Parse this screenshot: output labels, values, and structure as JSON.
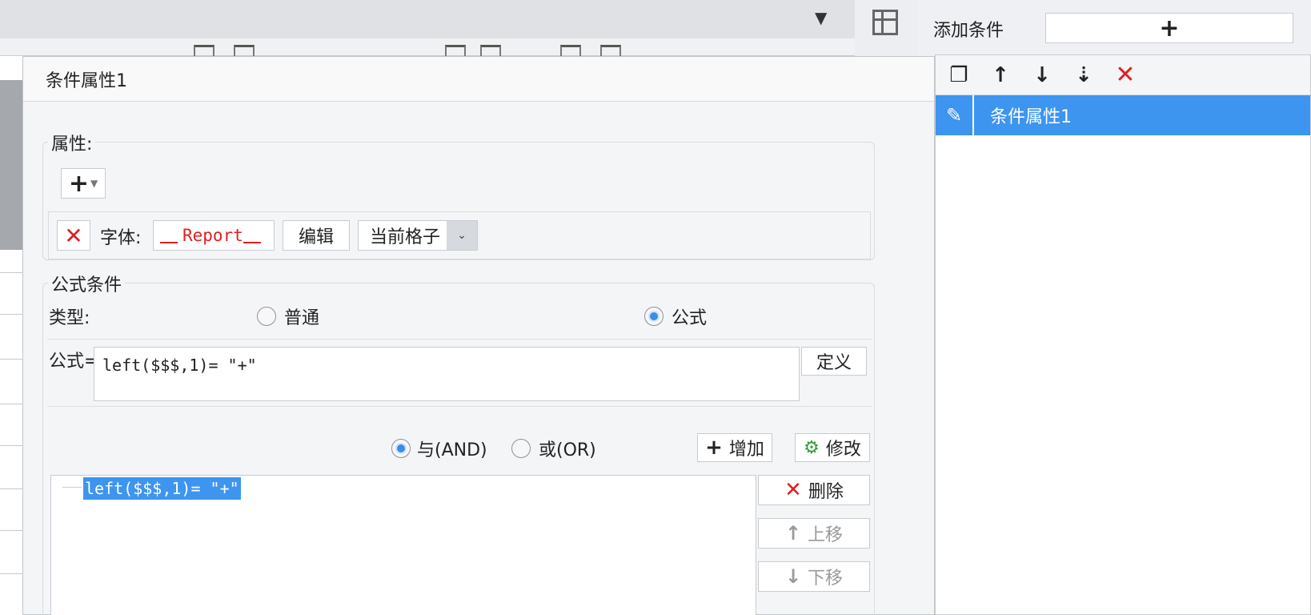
{
  "background": {
    "corner_icon": "dropdown-arrow-icon"
  },
  "right_panel": {
    "add_condition_label": "添加条件",
    "add_button_label": "+",
    "toolbar": [
      "copy-icon",
      "move-up-icon",
      "move-down-icon",
      "move-bottom-icon",
      "delete-icon"
    ],
    "items": [
      {
        "label": "条件属性1",
        "icon": "pencil-icon",
        "selected": true
      }
    ]
  },
  "dialog": {
    "title": "条件属性1",
    "properties": {
      "legend": "属性:",
      "add_label": "+",
      "font_label": "字体:",
      "font_preview": "Report",
      "edit_button": "编辑",
      "scope_select": "当前格子"
    },
    "formula_condition": {
      "legend": "公式条件",
      "type_label": "类型:",
      "type_options": [
        "普通",
        "公式"
      ],
      "type_selected": "公式",
      "formula_label": "公式=",
      "formula_value": "left($$$,1)= \"+\"",
      "define_button": "定义",
      "logic_options": [
        "与(AND)",
        "或(OR)"
      ],
      "logic_selected": "与(AND)",
      "add_button": "增加",
      "modify_button": "修改",
      "tree_item": "left($$$,1)= \"+\"",
      "delete_button": "删除",
      "up_button": "上移",
      "down_button": "下移"
    }
  },
  "colors": {
    "accent": "#3d95f0",
    "danger": "#e02020"
  }
}
